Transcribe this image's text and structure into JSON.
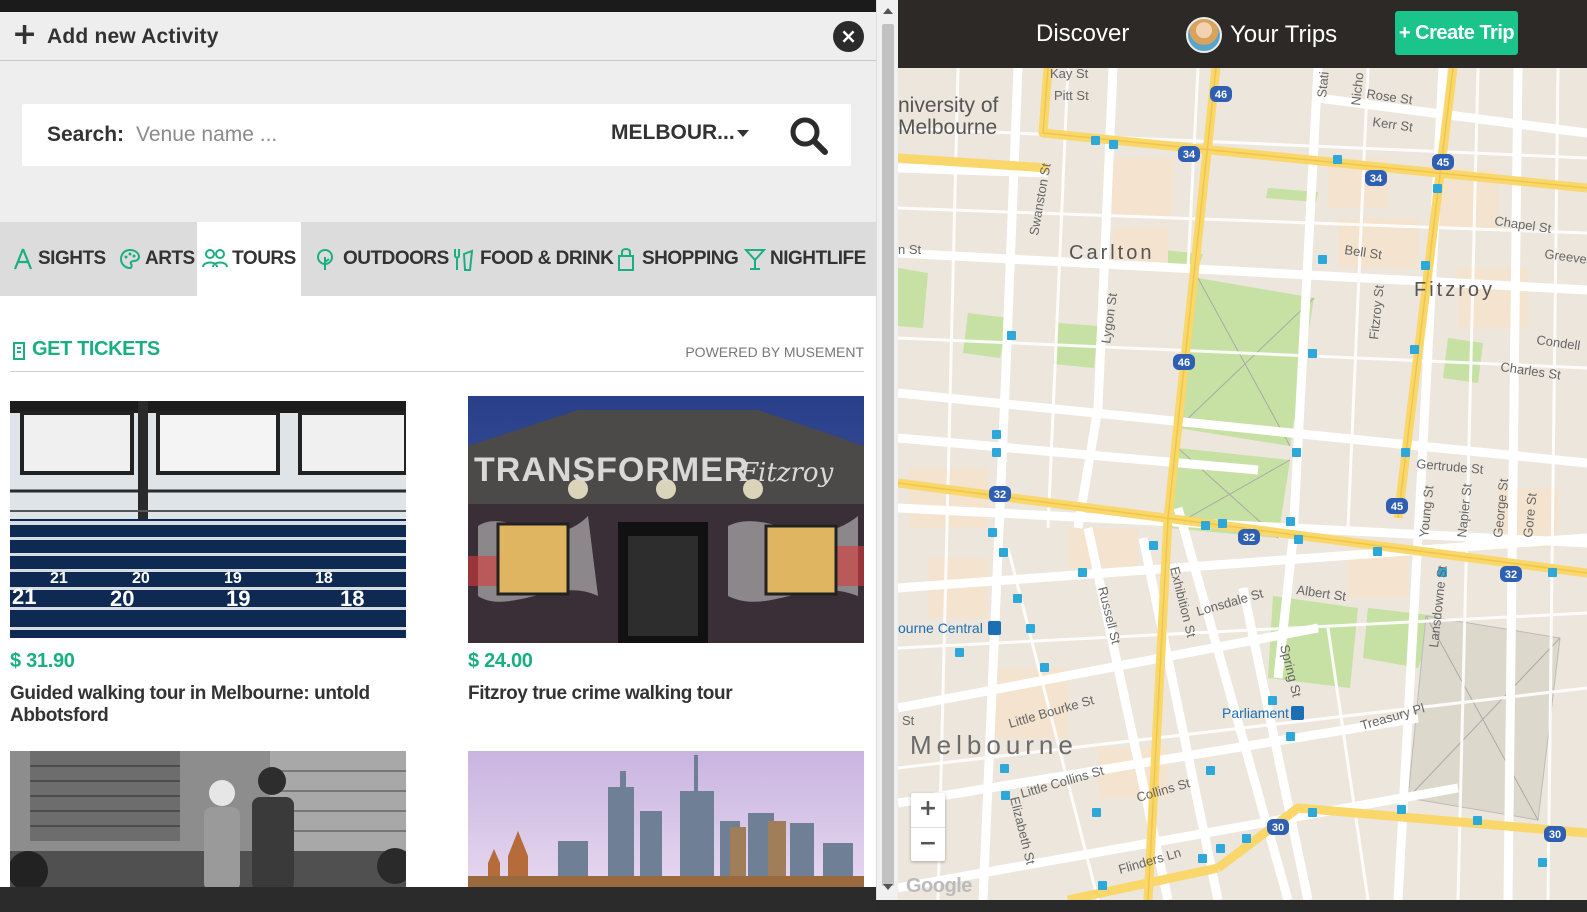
{
  "modal": {
    "title": "Add new Activity",
    "close_label": "×",
    "search": {
      "label": "Search:",
      "placeholder": "Venue name ...",
      "city": "MELBOUR..."
    },
    "tabs": [
      {
        "label": "SIGHTS",
        "icon": "sights-icon"
      },
      {
        "label": "ARTS",
        "icon": "palette-icon"
      },
      {
        "label": "TOURS",
        "icon": "people-icon",
        "active": true
      },
      {
        "label": "OUTDOORS",
        "icon": "tree-icon"
      },
      {
        "label": "FOOD & DRINK",
        "icon": "fork-cup-icon"
      },
      {
        "label": "SHOPPING",
        "icon": "bag-icon"
      },
      {
        "label": "NIGHTLIFE",
        "icon": "cocktail-icon"
      }
    ],
    "tickets": {
      "label": "GET TICKETS",
      "powered_by": "POWERED BY MUSEMENT"
    },
    "cards": [
      {
        "price": "$ 31.90",
        "name": "Guided walking tour in Melbourne: untold Abbotsford"
      },
      {
        "price": "$ 24.00",
        "name": "Fitzroy true crime walking tour"
      },
      {
        "price": "",
        "name": ""
      },
      {
        "price": "",
        "name": ""
      }
    ],
    "image_text": {
      "transformer": "TRANSFORMER",
      "fitzroy": "Fitzroy"
    }
  },
  "nav": {
    "discover": "Discover",
    "trips": "Your Trips",
    "create": "+ Create Trip"
  },
  "map": {
    "labels": {
      "uni": "niversity of",
      "uni2": "Melbourne",
      "carlton": "Carlton",
      "fitzroy": "Fitzroy",
      "melbourne": "Melbourne",
      "parliament": "Parliament",
      "central": "ourne Central",
      "streets": [
        "Kay St",
        "Pitt St",
        "Rose St",
        "Kerr St",
        "Swanston St",
        "Lygon St",
        "Bell St",
        "Chapel St",
        "Greeves",
        "Gertrude St",
        "Condell",
        "Charles St",
        "Albert St",
        "Lonsdale St",
        "Exhibition St",
        "Russell St",
        "Spring St",
        "Little Bourke St",
        "Little Collins St",
        "Collins St",
        "Flinders Ln",
        "Elizabeth St",
        "Lansdowne St",
        "Treasury Pl",
        "Fitzroy St",
        "Young St",
        "Napier St",
        "George St",
        "Gore St",
        "St",
        "n St",
        "Nicho",
        "Stati"
      ]
    },
    "routes": [
      "46",
      "46",
      "34",
      "34",
      "45",
      "45",
      "32",
      "32",
      "32",
      "30",
      "30"
    ],
    "zoom_in": "+",
    "zoom_out": "−",
    "attribution": "Google"
  },
  "colors": {
    "accent": "#1aaf82",
    "create_button": "#1bc48a",
    "nav_bg": "#2d2926",
    "map_road_major": "#f9d76a",
    "map_bg": "#ece6dc",
    "park": "#c7e0a3"
  }
}
